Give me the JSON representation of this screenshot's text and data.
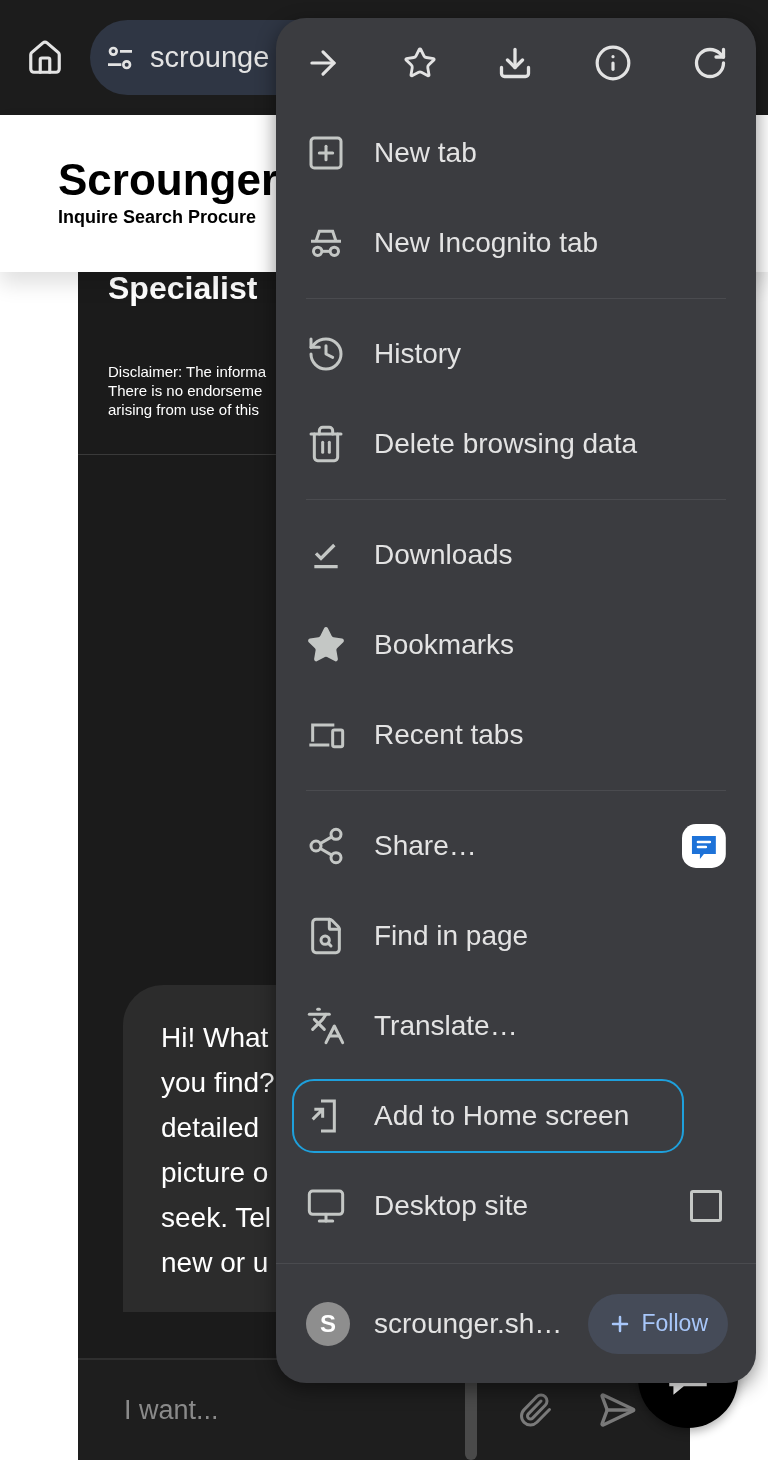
{
  "toolbar": {
    "address": "scrounge"
  },
  "site": {
    "logo_title": "Scrounger",
    "logo_tagline": "Inquire Search Procure",
    "heading": "Specialist",
    "disclaimer_lines": [
      "Disclaimer: The informa",
      "There is no endorseme",
      "arising from use of this"
    ]
  },
  "chat": {
    "message_lines": [
      "Hi! What",
      "you find?",
      "detailed",
      "picture o",
      "seek. Tel",
      "new or u"
    ],
    "input_placeholder": "I want..."
  },
  "menu": {
    "sections": [
      [
        {
          "kind": "new-tab",
          "label": "New tab",
          "highlighted": false
        },
        {
          "kind": "incognito",
          "label": "New Incognito tab",
          "highlighted": false
        }
      ],
      [
        {
          "kind": "history",
          "label": "History",
          "highlighted": false
        },
        {
          "kind": "delete",
          "label": "Delete browsing data",
          "highlighted": false
        }
      ],
      [
        {
          "kind": "downloads",
          "label": "Downloads",
          "highlighted": false
        },
        {
          "kind": "bookmarks",
          "label": "Bookmarks",
          "highlighted": false
        },
        {
          "kind": "recent",
          "label": "Recent tabs",
          "highlighted": false
        }
      ],
      [
        {
          "kind": "share",
          "label": "Share…",
          "highlighted": false
        },
        {
          "kind": "find",
          "label": "Find in page",
          "highlighted": false
        },
        {
          "kind": "translate",
          "label": "Translate…",
          "highlighted": false
        },
        {
          "kind": "add-home",
          "label": "Add to Home screen",
          "highlighted": true
        },
        {
          "kind": "desktop",
          "label": "Desktop site",
          "highlighted": false,
          "checked": false
        }
      ]
    ],
    "footer": {
      "avatar": "S",
      "site": "scrounger.sh…",
      "follow": "Follow"
    }
  }
}
